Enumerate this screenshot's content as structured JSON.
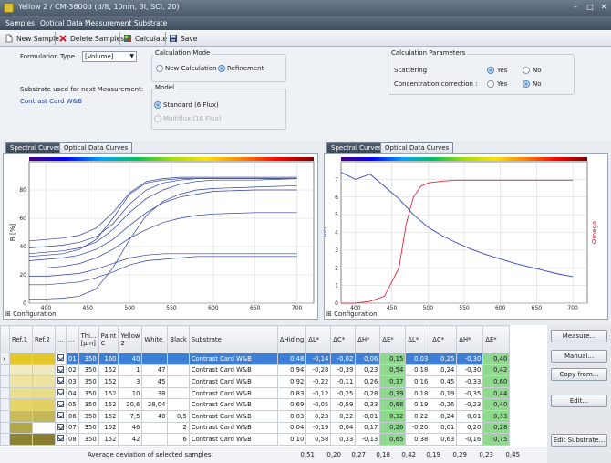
{
  "window": {
    "title": "Yellow 2 / CM-3600d (d/8, 10nm, 3I, SCI, 20)",
    "minimize": "–",
    "maximize": "□",
    "close": "✕"
  },
  "menu": [
    "Samples",
    "Optical Data",
    "Measurement Substrate"
  ],
  "toolbar": {
    "new_sample": "New Sample",
    "delete_samples": "Delete Samples",
    "calculate": "Calculate",
    "save": "Save"
  },
  "formulation": {
    "label": "Formulation Type :",
    "value": "[Volume]"
  },
  "substrate": {
    "label": "Substrate used for next Measurement:",
    "value": "Contrast Card W&B"
  },
  "calc_mode": {
    "title": "Calculation Mode",
    "new_calc": "New Calculation",
    "refinement": "Refinement",
    "selected": "refinement"
  },
  "model": {
    "title": "Model",
    "standard": "Standard (6 Flux)",
    "multiflux": "Multiflux (16 Flux)",
    "selected": "standard"
  },
  "calc_params": {
    "title": "Calculation Parameters",
    "scattering": "Scattering :",
    "concentration": "Concentration correction :",
    "yes": "Yes",
    "no": "No"
  },
  "left_pane": {
    "tab_active": "Spectral Curves",
    "tab_inactive": "Optical Data Curves",
    "config": "Configuration"
  },
  "right_pane": {
    "tab_active": "Spectral Curves",
    "tab_inactive": "Optical Data Curves",
    "config": "Configuration"
  },
  "chart_data": [
    {
      "type": "line",
      "xlabel": "nm",
      "ylabel": "R [%]",
      "xlim": [
        380,
        720
      ],
      "ylim": [
        0,
        100
      ],
      "xticks": [
        "400",
        "450",
        "500",
        "550",
        "600",
        "650",
        "700"
      ],
      "yticks": [
        "0",
        "20",
        "40",
        "60",
        "80"
      ],
      "x": [
        380,
        400,
        420,
        440,
        460,
        480,
        500,
        520,
        540,
        560,
        580,
        600,
        650,
        700
      ],
      "series": [
        {
          "values": [
            3,
            3,
            3.5,
            5,
            10,
            25,
            45,
            62,
            72,
            77,
            80,
            81,
            82,
            83
          ]
        },
        {
          "values": [
            13,
            13,
            14,
            15,
            18,
            22,
            27,
            30,
            31,
            32,
            33,
            33,
            33,
            33
          ]
        },
        {
          "values": [
            19,
            19,
            20,
            21,
            24,
            28,
            32,
            34,
            35,
            35,
            35,
            35,
            35,
            35
          ]
        },
        {
          "values": [
            25,
            25,
            26,
            28,
            32,
            38,
            46,
            52,
            57,
            60,
            62,
            63,
            64,
            64
          ]
        },
        {
          "values": [
            30,
            31,
            32,
            34,
            38,
            45,
            55,
            64,
            71,
            75,
            77,
            79,
            80,
            80
          ]
        },
        {
          "values": [
            35,
            36,
            37,
            39,
            43,
            52,
            64,
            74,
            80,
            84,
            86,
            87,
            87,
            88
          ]
        },
        {
          "values": [
            39,
            40,
            41,
            43,
            47,
            56,
            70,
            80,
            85,
            87,
            88,
            88,
            88,
            88
          ]
        },
        {
          "values": [
            33,
            34,
            35,
            38,
            45,
            60,
            77,
            85,
            87,
            88,
            88,
            88,
            88,
            88
          ]
        },
        {
          "values": [
            44,
            45,
            46,
            48,
            53,
            64,
            78,
            86,
            88,
            89,
            89,
            89,
            89,
            89
          ]
        }
      ]
    },
    {
      "type": "line",
      "xlabel": "nm",
      "ylabel": "Tau",
      "ylabel_right": "Omega",
      "xlim": [
        380,
        720
      ],
      "ylim": [
        0,
        8
      ],
      "xticks": [
        "400",
        "450",
        "500",
        "550",
        "600",
        "650",
        "700"
      ],
      "yticks": [
        "0",
        "1",
        "2",
        "3",
        "4",
        "5",
        "6",
        "7"
      ],
      "series": [
        {
          "name": "Tau",
          "color": "#3347b8",
          "x": [
            380,
            400,
            420,
            440,
            460,
            480,
            500,
            520,
            540,
            560,
            580,
            600,
            620,
            640,
            660,
            680,
            700
          ],
          "values": [
            7.4,
            7.0,
            7.3,
            6.6,
            5.9,
            5.0,
            4.3,
            3.8,
            3.4,
            3.05,
            2.75,
            2.5,
            2.25,
            2.05,
            1.85,
            1.65,
            1.5
          ]
        },
        {
          "name": "Omega",
          "color": "#e0283a",
          "x": [
            380,
            400,
            420,
            440,
            460,
            470,
            480,
            490,
            500,
            520,
            540,
            560,
            600,
            650,
            700
          ],
          "values": [
            0,
            0,
            0.1,
            0.4,
            2.0,
            4.5,
            6.0,
            6.6,
            6.8,
            6.9,
            6.95,
            6.95,
            6.95,
            6.95,
            6.95
          ]
        }
      ]
    }
  ],
  "table": {
    "headers": [
      "Ref.1",
      "Ref.2",
      "...",
      "...",
      "Thi... [µm]",
      "Paint C",
      "Yellow 2",
      "White",
      "Black",
      "Substrate",
      "ΔHiding",
      "ΔL*",
      "ΔC*",
      "ΔH*",
      "ΔE*",
      "ΔL*",
      "ΔC*",
      "ΔH*",
      "ΔE*"
    ],
    "rows": [
      {
        "ref1": "#e4c92a",
        "ref2": "#e2c72a",
        "id": "01",
        "thick": "350",
        "paint": "160",
        "yellow": "40",
        "white": "",
        "black": "",
        "substrate": "Contrast Card W&B",
        "hiding": "0,48",
        "l1": "-0,14",
        "c1": "-0,02",
        "h1": "0,06",
        "e1": "0,15",
        "l2": "0,03",
        "c2": "0,25",
        "h2": "-0,30",
        "e2": "0,40"
      },
      {
        "ref1": "#f3ecc3",
        "ref2": "#f0e9c0",
        "id": "02",
        "thick": "350",
        "paint": "152",
        "yellow": "1",
        "white": "47",
        "black": "",
        "substrate": "Contrast Card W&B",
        "hiding": "0,94",
        "l1": "-0,28",
        "c1": "-0,39",
        "h1": "0,23",
        "e1": "0,54",
        "l2": "0,18",
        "c2": "0,24",
        "h2": "-0,30",
        "e2": "0,42"
      },
      {
        "ref1": "#efe5a3",
        "ref2": "#ede2a0",
        "id": "03",
        "thick": "350",
        "paint": "152",
        "yellow": "3",
        "white": "45",
        "black": "",
        "substrate": "Contrast Card W&B",
        "hiding": "0,92",
        "l1": "-0,22",
        "c1": "-0,11",
        "h1": "0,26",
        "e1": "0,37",
        "l2": "0,16",
        "c2": "0,45",
        "h2": "-0,33",
        "e2": "0,60"
      },
      {
        "ref1": "#ebe08a",
        "ref2": "#e8dc86",
        "id": "04",
        "thick": "350",
        "paint": "152",
        "yellow": "10",
        "white": "38",
        "black": "",
        "substrate": "Contrast Card W&B",
        "hiding": "0,83",
        "l1": "-0,12",
        "c1": "-0,25",
        "h1": "0,28",
        "e1": "0,39",
        "l2": "0,18",
        "c2": "0,19",
        "h2": "-0,35",
        "e2": "0,44"
      },
      {
        "ref1": "#e4d565",
        "ref2": "#e1d163",
        "id": "05",
        "thick": "350",
        "paint": "152",
        "yellow": "20,6",
        "white": "28,04",
        "black": "",
        "substrate": "Contrast Card W&B",
        "hiding": "0,69",
        "l1": "-0,05",
        "c1": "-0,59",
        "h1": "0,33",
        "e1": "0,68",
        "l2": "0,19",
        "c2": "-0,26",
        "h2": "-0,23",
        "e2": "0,40"
      },
      {
        "ref1": "#c9bc5d",
        "ref2": "#c4b759",
        "id": "06",
        "thick": "350",
        "paint": "152",
        "yellow": "7,5",
        "white": "40",
        "black": "0,5",
        "substrate": "Contrast Card W&B",
        "hiding": "0,03",
        "l1": "0,23",
        "c1": "0,22",
        "h1": "-0,01",
        "e1": "0,32",
        "l2": "0,22",
        "c2": "0,24",
        "h2": "-0,01",
        "e2": "0,33"
      },
      {
        "ref1": "#b2a64b",
        "ref2": "#ad2a148",
        "id": "07",
        "thick": "350",
        "paint": "152",
        "yellow": "46",
        "white": "",
        "black": "2",
        "substrate": "Contrast Card W&B",
        "hiding": "0,04",
        "l1": "-0,19",
        "c1": "0,04",
        "h1": "0,17",
        "e1": "0,26",
        "l2": "-0,20",
        "c2": "0,01",
        "h2": "0,20",
        "e2": "0,28"
      },
      {
        "ref1": "#8d8232",
        "ref2": "#887d30",
        "id": "08",
        "thick": "350",
        "paint": "152",
        "yellow": "42",
        "white": "",
        "black": "6",
        "substrate": "Contrast Card W&B",
        "hiding": "0,10",
        "l1": "0,58",
        "c1": "0,33",
        "h1": "-0,13",
        "e1": "0,65",
        "l2": "0,38",
        "c2": "0,63",
        "h2": "-0,16",
        "e2": "0,75"
      }
    ],
    "average": {
      "label": "Average deviation of selected samples:",
      "values": [
        "0,51",
        "0,20",
        "0,27",
        "0,18",
        "0,42",
        "0,19",
        "0,29",
        "0,23",
        "0,45"
      ]
    }
  },
  "side_buttons": {
    "measure": "Measure...",
    "manual": "Manual...",
    "copy_from": "Copy from...",
    "edit": "Edit...",
    "edit_substrate": "Edit Substrate..."
  }
}
